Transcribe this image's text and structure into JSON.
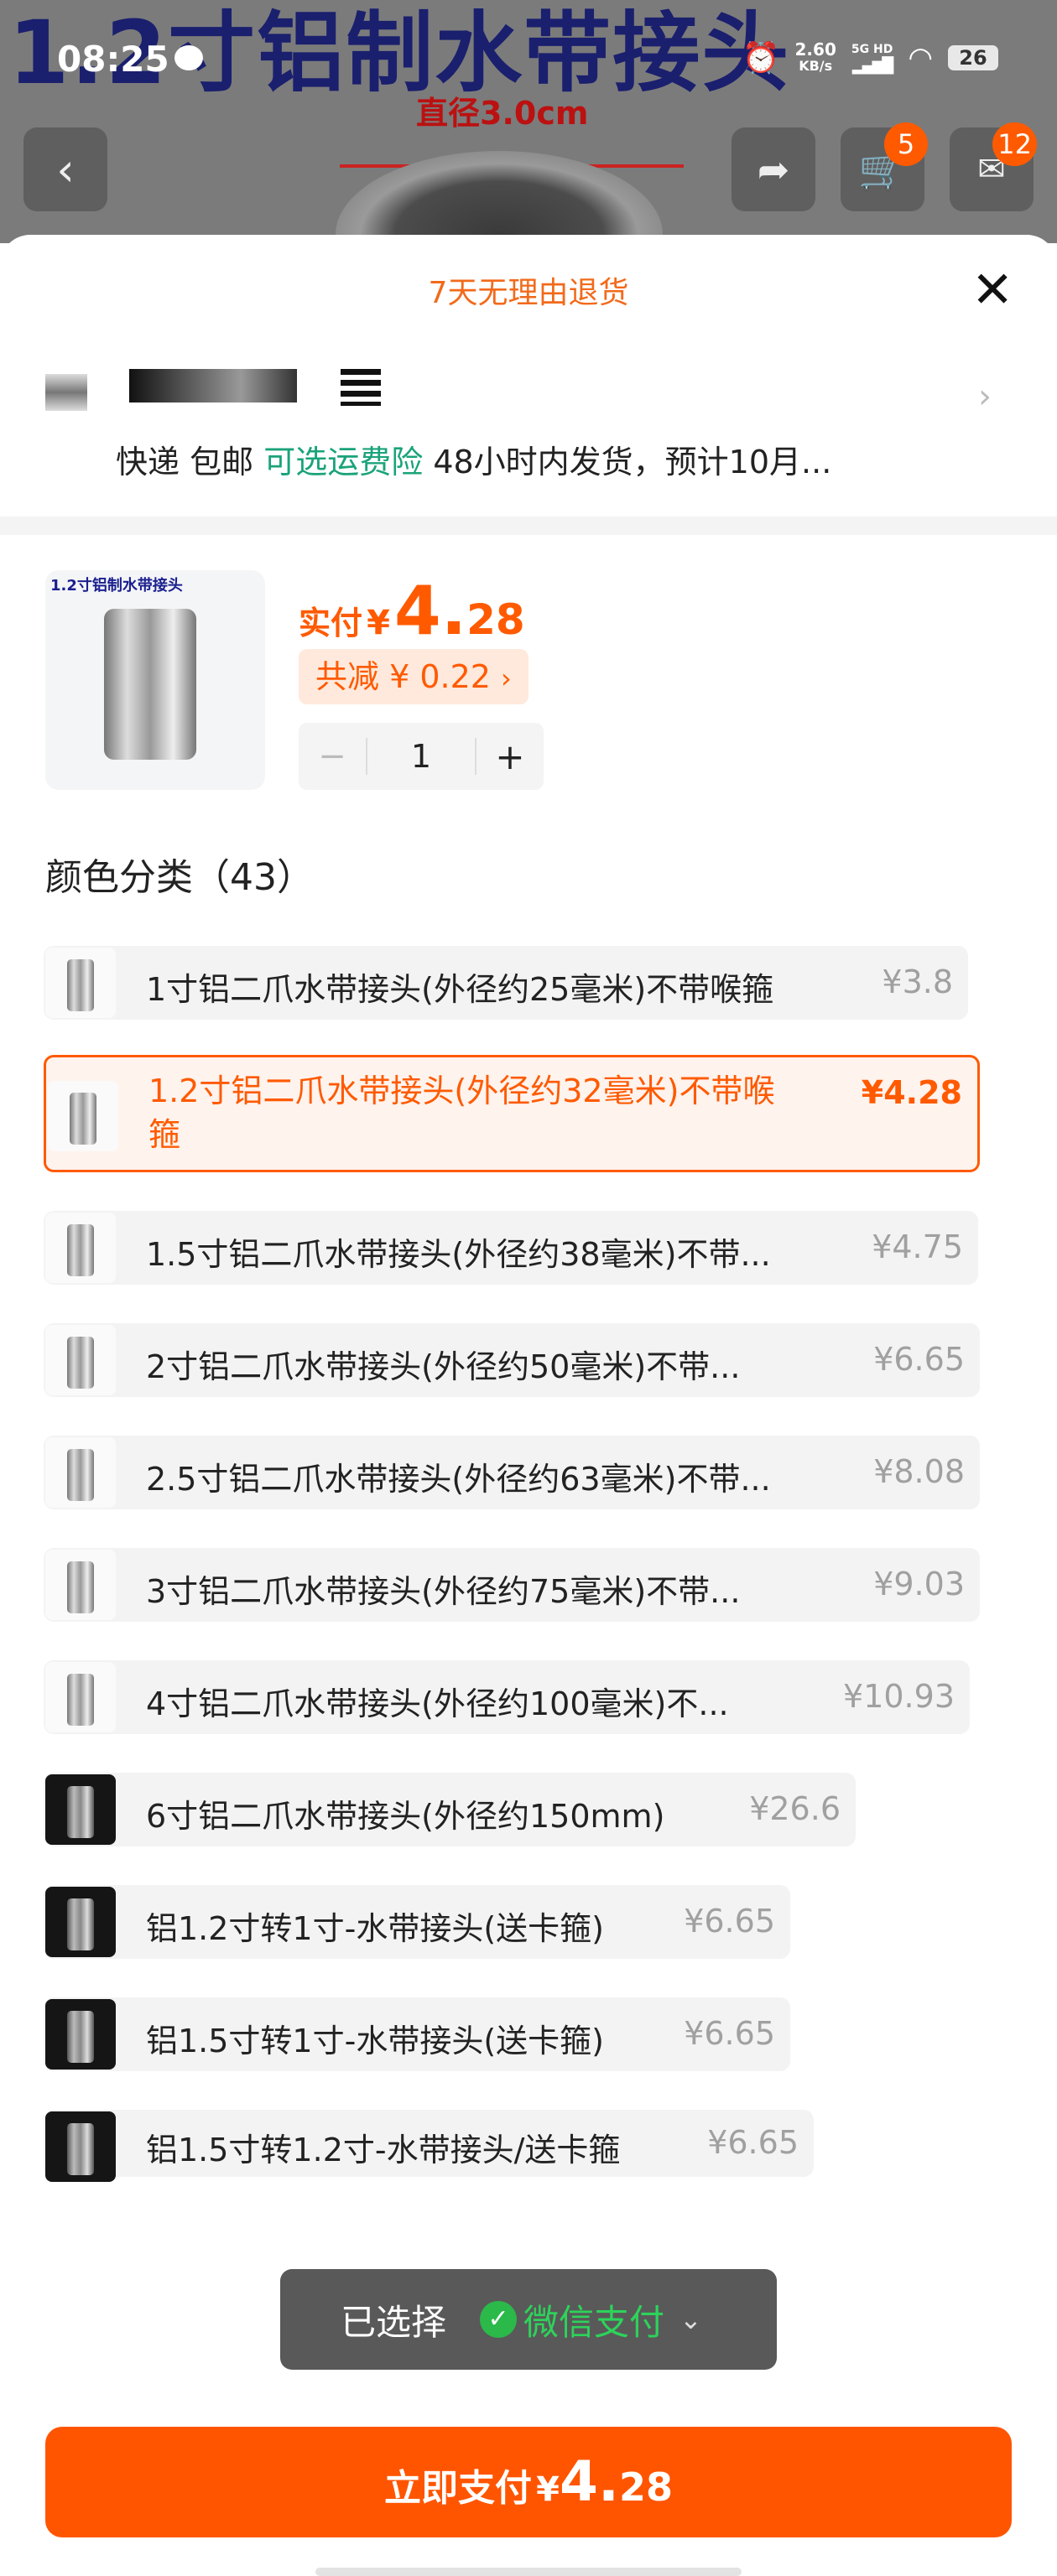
{
  "background": {
    "product_title": "1.2寸铝制水带接头",
    "dimension_label": "直径3.0cm"
  },
  "status_bar": {
    "time": "08:25",
    "net_speed": "2.60",
    "net_unit": "KB/s",
    "net_type": "5G HD",
    "battery": "26"
  },
  "nav": {
    "cart_badge": "5",
    "message_badge": "12"
  },
  "sheet": {
    "return_policy": "7天无理由退货",
    "shipping": {
      "express": "快递",
      "free_shipping": "包邮",
      "insurance": "可选运费险",
      "dispatch": "48小时内发货，预计10月..."
    }
  },
  "product": {
    "image_caption": "1.2寸铝制水带接头",
    "pay_label": "实付",
    "currency": "¥",
    "price_int": "4.",
    "price_dec": "28",
    "discount": "共减 ¥ 0.22",
    "quantity": "1",
    "minus": "−",
    "plus": "+"
  },
  "category_title": "颜色分类（43）",
  "options": [
    {
      "label": "1寸铝二爪水带接头(外径约25毫米)不带喉箍",
      "price": "¥3.8"
    },
    {
      "label": "1.2寸铝二爪水带接头(外径约32毫米)不带喉箍",
      "price": "¥4.28",
      "selected": true
    },
    {
      "label": "1.5寸铝二爪水带接头(外径约38毫米)不带...",
      "price": "¥4.75"
    },
    {
      "label": "2寸铝二爪水带接头(外径约50毫米)不带...",
      "price": "¥6.65"
    },
    {
      "label": "2.5寸铝二爪水带接头(外径约63毫米)不带...",
      "price": "¥8.08"
    },
    {
      "label": "3寸铝二爪水带接头(外径约75毫米)不带...",
      "price": "¥9.03"
    },
    {
      "label": "4寸铝二爪水带接头(外径约100毫米)不...",
      "price": "¥10.93"
    },
    {
      "label": "6寸铝二爪水带接头(外径约150mm)",
      "price": "¥26.6"
    },
    {
      "label": "铝1.2寸转1寸-水带接头(送卡箍)",
      "price": "¥6.65"
    },
    {
      "label": "铝1.5寸转1寸-水带接头(送卡箍)",
      "price": "¥6.65"
    },
    {
      "label": "铝1.5寸转1.2寸-水带接头/送卡箍",
      "price": "¥6.65"
    }
  ],
  "toast": {
    "selected_label": "已选择",
    "method": "微信支付"
  },
  "pay_button": {
    "label": "立即支付",
    "currency": "¥",
    "price_int": "4.",
    "price_dec": "28"
  },
  "colors": {
    "accent": "#ff5500",
    "green": "#1aa37a",
    "wechat": "#2bb94a"
  }
}
